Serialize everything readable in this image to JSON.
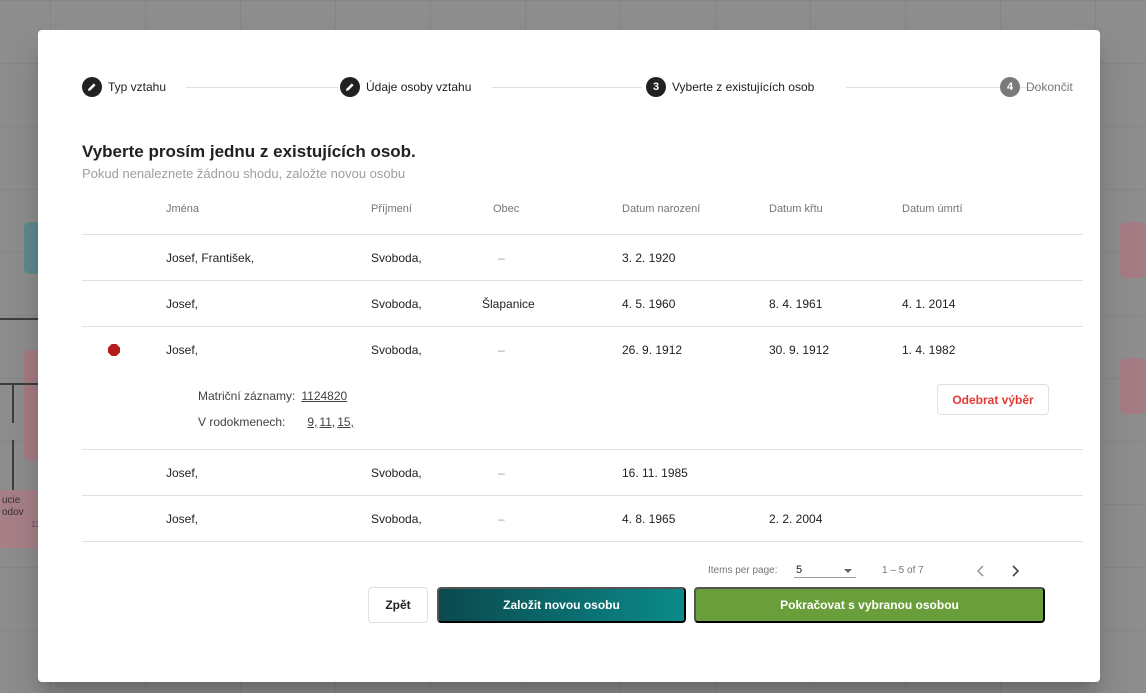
{
  "background": {
    "person_card": {
      "line1": "ucie",
      "line2": "odov",
      "number": "13"
    }
  },
  "stepper": {
    "steps": [
      {
        "label": "Typ vztahu",
        "icon": "pencil-icon",
        "state": "done"
      },
      {
        "label": "Údaje osoby vztahu",
        "icon": "pencil-icon",
        "state": "done"
      },
      {
        "number": "3",
        "label": "Vyberte z existujících osob",
        "state": "active"
      },
      {
        "number": "4",
        "label": "Dokončit",
        "state": "pending"
      }
    ]
  },
  "heading": {
    "title": "Vyberte prosím jednu z existujících osob.",
    "subtitle": "Pokud nenaleznete žádnou shodu, založte novou osobu"
  },
  "table": {
    "columns": [
      "Jména",
      "Příjmení",
      "Obec",
      "Datum narození",
      "Datum křtu",
      "Datum úmrtí"
    ],
    "rows": [
      {
        "names": "Josef, František,",
        "surname": "Svoboda,",
        "obec": "–",
        "born": "3. 2. 1920",
        "baptized": "",
        "died": ""
      },
      {
        "names": "Josef,",
        "surname": "Svoboda,",
        "obec": "Šlapanice",
        "born": "4. 5. 1960",
        "baptized": "8. 4. 1961",
        "died": "4. 1. 2014"
      },
      {
        "names": "Josef,",
        "surname": "Svoboda,",
        "obec": "–",
        "born": "26. 9. 1912",
        "baptized": "30. 9. 1912",
        "died": "1. 4. 1982"
      },
      {
        "names": "Josef,",
        "surname": "Svoboda,",
        "obec": "–",
        "born": "16. 11. 1985",
        "baptized": "",
        "died": ""
      },
      {
        "names": "Josef,",
        "surname": "Svoboda,",
        "obec": "–",
        "born": "4. 8. 1965",
        "baptized": "2. 2. 2004",
        "died": ""
      }
    ],
    "selected": {
      "records_label": "Matriční záznamy:",
      "records": [
        "1124820"
      ],
      "trees_label": "V rodokmenech:",
      "trees": [
        "9,",
        "11,",
        "15,"
      ],
      "remove_label": "Odebrat výběr"
    }
  },
  "paginator": {
    "items_per_page_label": "Items per page:",
    "page_size": "5",
    "range": "1 – 5 of 7"
  },
  "actions": {
    "back": "Zpět",
    "create_new": "Založit novou osobu",
    "continue": "Pokračovat s vybranou osobou"
  },
  "colors": {
    "accent_teal_start": "#0a4a4e",
    "accent_teal_end": "#0b8a8a",
    "continue_green": "#6a9e3a",
    "remove_red": "#e53935",
    "selected_marker": "#b71c1c"
  }
}
